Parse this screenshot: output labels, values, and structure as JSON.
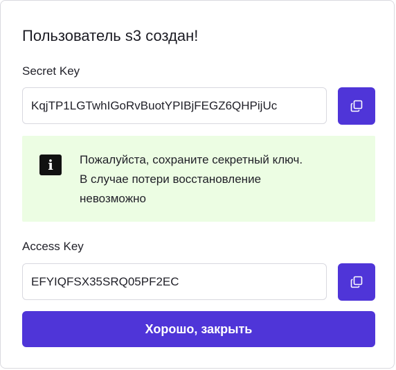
{
  "dialog": {
    "title": "Пользователь s3 создан!",
    "secret_key": {
      "label": "Secret Key",
      "value": "KqjTP1LGTwhIGoRvBuotYPIBjFEGZ6QHPijUc",
      "copy_icon": "copy-icon"
    },
    "notice": {
      "icon": "info-icon",
      "icon_glyph": "i",
      "lines": [
        "Пожалуйста, сохраните секретный ключ.",
        "В случае потери восстановление",
        "невозможно"
      ]
    },
    "access_key": {
      "label": "Access Key",
      "value": "EFYIQFSX35SRQ05PF2EC",
      "copy_icon": "copy-icon"
    },
    "confirm_button": "Хорошо, закрыть"
  },
  "colors": {
    "accent": "#4f35d8",
    "notice_background": "#ecfde3",
    "text": "#1f1f27",
    "border": "#d8d8df"
  }
}
